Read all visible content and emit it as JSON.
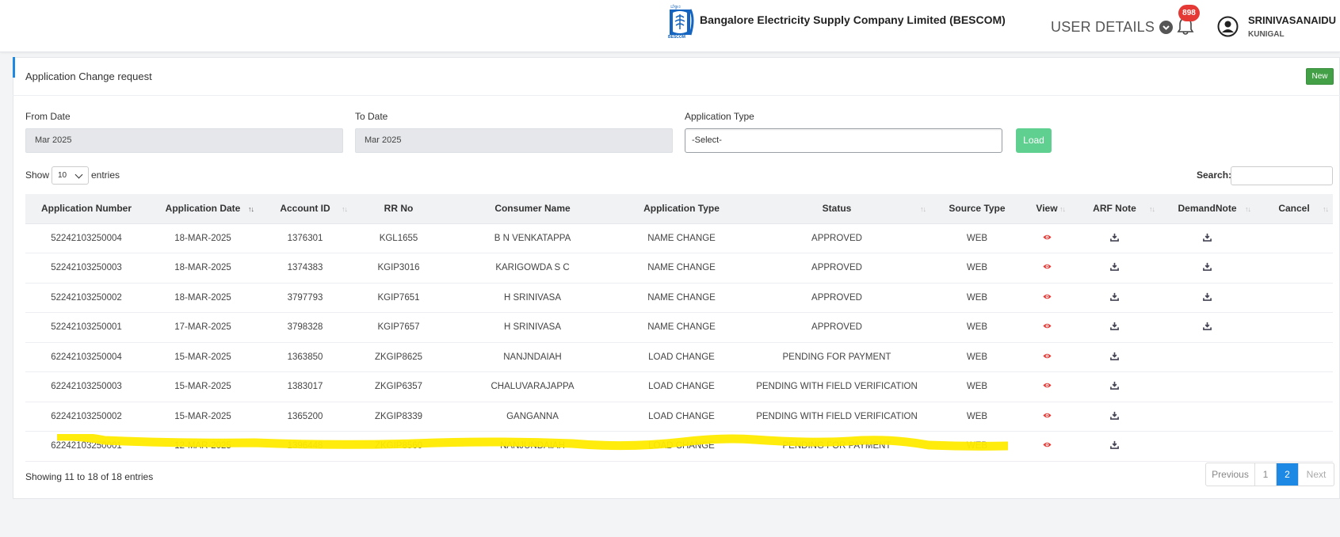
{
  "header": {
    "company_name": "Bangalore Electricity Supply Company Limited (BESCOM)",
    "logo_text": "BESCOM",
    "user_details_label": "USER DETAILS",
    "notification_count": "898",
    "user_name": "SRINIVASANAIDU",
    "user_location": "KUNIGAL"
  },
  "page": {
    "title": "Application Change request",
    "new_button": "New"
  },
  "filters": {
    "from_date_label": "From Date",
    "from_date_value": "Mar 2025",
    "to_date_label": "To Date",
    "to_date_value": "Mar 2025",
    "app_type_label": "Application Type",
    "app_type_value": "-Select-",
    "load_button": "Load"
  },
  "table_controls": {
    "show_label": "Show",
    "page_size": "10",
    "entries_label": "entries",
    "search_label": "Search:"
  },
  "table": {
    "columns": [
      "Application Number",
      "Application Date",
      "Account ID",
      "RR No",
      "Consumer Name",
      "Application Type",
      "Status",
      "Source Type",
      "View",
      "ARF Note",
      "DemandNote",
      "Cancel"
    ],
    "rows": [
      {
        "app_no": "52242103250004",
        "date": "18-MAR-2025",
        "account": "1376301",
        "rr": "KGL1655",
        "name": "B N VENKATAPPA",
        "type": "NAME CHANGE",
        "status": "APPROVED",
        "source": "WEB",
        "demand": true
      },
      {
        "app_no": "52242103250003",
        "date": "18-MAR-2025",
        "account": "1374383",
        "rr": "KGIP3016",
        "name": "KARIGOWDA S C",
        "type": "NAME CHANGE",
        "status": "APPROVED",
        "source": "WEB",
        "demand": true
      },
      {
        "app_no": "52242103250002",
        "date": "18-MAR-2025",
        "account": "3797793",
        "rr": "KGIP7651",
        "name": "H SRINIVASA",
        "type": "NAME CHANGE",
        "status": "APPROVED",
        "source": "WEB",
        "demand": true
      },
      {
        "app_no": "52242103250001",
        "date": "17-MAR-2025",
        "account": "3798328",
        "rr": "KGIP7657",
        "name": "H SRINIVASA",
        "type": "NAME CHANGE",
        "status": "APPROVED",
        "source": "WEB",
        "demand": true
      },
      {
        "app_no": "62242103250004",
        "date": "15-MAR-2025",
        "account": "1363850",
        "rr": "ZKGIP8625",
        "name": "NANJNDAIAH",
        "type": "LOAD CHANGE",
        "status": "PENDING FOR PAYMENT",
        "source": "WEB",
        "demand": false
      },
      {
        "app_no": "62242103250003",
        "date": "15-MAR-2025",
        "account": "1383017",
        "rr": "ZKGIP6357",
        "name": "CHALUVARAJAPPA",
        "type": "LOAD CHANGE",
        "status": "PENDING WITH FIELD VERIFICATION",
        "source": "WEB",
        "demand": false
      },
      {
        "app_no": "62242103250002",
        "date": "15-MAR-2025",
        "account": "1365200",
        "rr": "ZKGIP8339",
        "name": "GANGANNA",
        "type": "LOAD CHANGE",
        "status": "PENDING WITH FIELD VERIFICATION",
        "source": "WEB",
        "demand": false
      },
      {
        "app_no": "62242103250001",
        "date": "12-MAR-2025",
        "account": "1396448",
        "rr": "ZKGIP8560",
        "name": "NANJUNDAIAH",
        "type": "LOAD CHANGE",
        "status": "PENDING FOR PAYMENT",
        "source": "WEB",
        "demand": false
      }
    ]
  },
  "footer": {
    "info": "Showing 11 to 18 of 18 entries",
    "previous": "Previous",
    "page1": "1",
    "page2": "2",
    "next": "Next"
  },
  "colors": {
    "accent_blue": "#1e88e5",
    "new_green": "#43a047",
    "load_green": "#5fd090",
    "eye_red": "#e53935",
    "highlight_yellow": "#ffeb00"
  }
}
